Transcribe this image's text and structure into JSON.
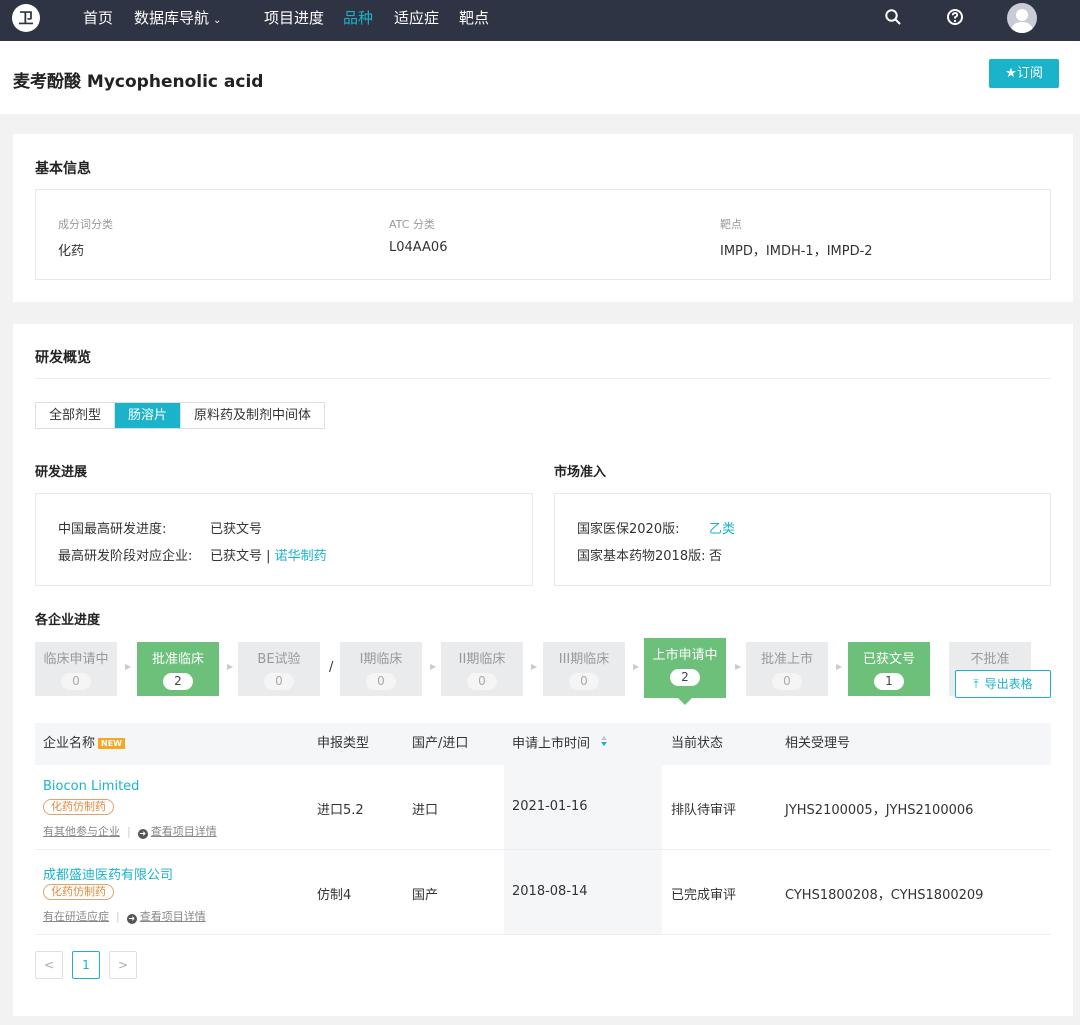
{
  "nav": {
    "logo_glyph": "卫",
    "items": [
      {
        "label": "首页",
        "active": false
      },
      {
        "label": "数据库导航",
        "active": false,
        "has_caret": true
      },
      {
        "label": "项目进度",
        "active": false
      },
      {
        "label": "品种",
        "active": true
      },
      {
        "label": "适应症",
        "active": false
      },
      {
        "label": "靶点",
        "active": false
      }
    ],
    "caret": "⌄",
    "icons": [
      "search-icon",
      "help-icon",
      "user-avatar"
    ]
  },
  "header": {
    "title": "麦考酚酸 Mycophenolic acid",
    "subscribe_label": "★订阅"
  },
  "basic_info": {
    "title": "基本信息",
    "fields": [
      {
        "label": "成分词分类",
        "value": "化药"
      },
      {
        "label": "ATC 分类",
        "value": "L04AA06"
      },
      {
        "label": "靶点",
        "value": "IMPD，IMDH-1，IMPD-2"
      }
    ]
  },
  "dev_overview": {
    "title": "研发概览",
    "tabs": [
      {
        "label": "全部剂型",
        "active": false
      },
      {
        "label": "肠溶片",
        "active": true
      },
      {
        "label": "原料药及制剂中间体",
        "active": false
      }
    ],
    "progress": {
      "title": "研发进展",
      "rows": [
        {
          "label": "中国最高研发进度:",
          "value": "已获文号",
          "link": ""
        },
        {
          "label": "最高研发阶段对应企业:",
          "value": "已获文号 | ",
          "link": "诺华制药"
        }
      ]
    },
    "market": {
      "title": "市场准入",
      "rows": [
        {
          "label": "国家医保2020版:",
          "value": "",
          "link": "乙类"
        },
        {
          "label": "国家基本药物2018版:",
          "value": "否",
          "link": ""
        }
      ]
    },
    "company_progress_title": "各企业进度",
    "stages": [
      {
        "label": "临床申请中",
        "count": "0",
        "active": false
      },
      {
        "label": "批准临床",
        "count": "2",
        "active": true
      },
      {
        "label": "BE试验",
        "count": "0",
        "active": false
      },
      {
        "label": "I期临床",
        "count": "0",
        "active": false
      },
      {
        "label": "II期临床",
        "count": "0",
        "active": false
      },
      {
        "label": "III期临床",
        "count": "0",
        "active": false
      },
      {
        "label": "上市申请中",
        "count": "2",
        "active": true,
        "selected": true
      },
      {
        "label": "批准上市",
        "count": "0",
        "active": false
      },
      {
        "label": "已获文号",
        "count": "1",
        "active": true
      },
      {
        "label": "不批准",
        "count": "",
        "active": false
      }
    ],
    "stage_slash": "/",
    "export_label": "导出表格",
    "table": {
      "headers": [
        "企业名称",
        "申报类型",
        "国产/进口",
        "申请上市时间",
        "当前状态",
        "相关受理号"
      ],
      "new_badge": "NEW",
      "rows": [
        {
          "company": "Biocon Limited",
          "tag": "化药仿制药",
          "action1": "有其他参与企业",
          "action2": "查看项目详情",
          "type": "进口5.2",
          "origin": "进口",
          "date": "2021-01-16",
          "status": "排队待审评",
          "numbers": "JYHS2100005，JYHS2100006"
        },
        {
          "company": "成都盛迪医药有限公司",
          "tag": "化药仿制药",
          "action1": "有在研适应症",
          "action2": "查看项目详情",
          "type": "仿制4",
          "origin": "国产",
          "date": "2018-08-14",
          "status": "已完成审评",
          "numbers": "CYHS1800208，CYHS1800209"
        }
      ]
    },
    "pagination": {
      "prev": "<",
      "current": "1",
      "next": ">"
    }
  },
  "colors": {
    "accent": "#1ab3c9",
    "nav_bg": "#2f3444",
    "stage_active": "#6cc07a",
    "tag_orange": "#e08a40"
  }
}
